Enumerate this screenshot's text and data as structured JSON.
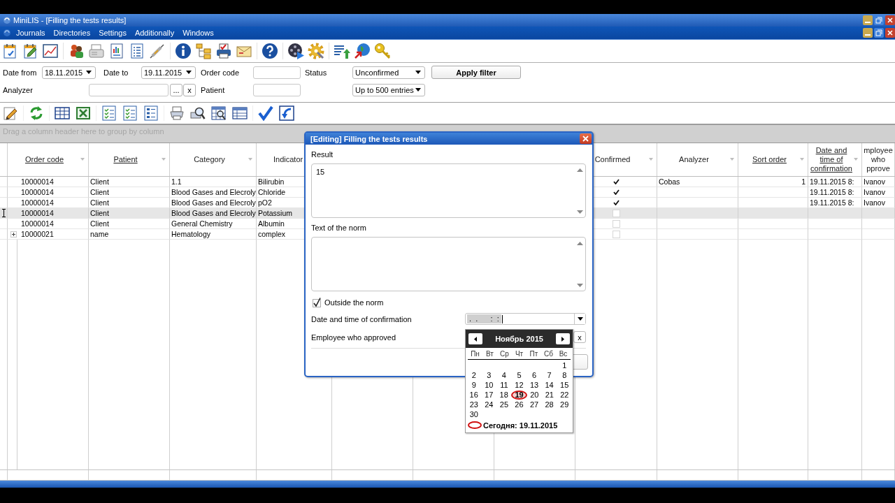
{
  "window": {
    "title": "MiniLIS - [Filling the tests results]"
  },
  "menu": [
    "Journals",
    "Directories",
    "Settings",
    "Additionally",
    "Windows"
  ],
  "filters": {
    "date_from": {
      "label": "Date from",
      "value": "18.11.2015"
    },
    "date_to": {
      "label": "Date to",
      "value": "19.11.2015"
    },
    "order_code": {
      "label": "Order code"
    },
    "status": {
      "label": "Status",
      "value": "Unconfirmed"
    },
    "apply_button": "Apply filter",
    "analyzer": {
      "label": "Analyzer",
      "browse_button": "...",
      "clear_button": "x"
    },
    "patient": {
      "label": "Patient"
    },
    "limit": {
      "value": "Up to 500 entries"
    }
  },
  "grid": {
    "group_hint": "Drag a column header here to group by column",
    "columns": [
      {
        "label": "Order code",
        "underlined": true,
        "filter_mark": true
      },
      {
        "label": "Patient",
        "underlined": true,
        "filter_mark": true
      },
      {
        "label": "Category",
        "underlined": false,
        "filter_mark": true
      },
      {
        "label": "Indicator",
        "underlined": false,
        "filter_mark": false
      },
      {
        "label": "Confirmed",
        "underlined": false,
        "filter_mark": true
      },
      {
        "label": "Analyzer",
        "underlined": false,
        "filter_mark": true
      },
      {
        "label": "Sort order",
        "underlined": true,
        "filter_mark": true
      },
      {
        "label": "Date and time of confirmation",
        "underlined": true,
        "filter_mark": true
      },
      {
        "label": "mployee who pprove",
        "underlined": false,
        "filter_mark": false
      }
    ],
    "rows": [
      {
        "selected": false,
        "expandable": false,
        "order_code": "10000014",
        "patient": "Client",
        "category": "1.1",
        "indicator": "Bilirubin",
        "confirmed": true,
        "analyzer": "Cobas",
        "sort_order": "1",
        "confirmed_at": "19.11.2015 8:",
        "approved_by": "Ivanov"
      },
      {
        "selected": false,
        "expandable": false,
        "order_code": "10000014",
        "patient": "Client",
        "category": "Blood Gases and Elecroly",
        "indicator": "Chloride",
        "confirmed": true,
        "confirmed_at": "19.11.2015 8:",
        "approved_by": "Ivanov"
      },
      {
        "selected": false,
        "expandable": false,
        "order_code": "10000014",
        "patient": "Client",
        "category": "Blood Gases and Elecroly",
        "indicator": "pO2",
        "confirmed": true,
        "confirmed_at": "19.11.2015 8:",
        "approved_by": "Ivanov"
      },
      {
        "selected": true,
        "expandable": false,
        "order_code": "10000014",
        "patient": "Client",
        "category": "Blood Gases and Elecroly",
        "indicator": "Potassium",
        "confirmed": false
      },
      {
        "selected": false,
        "expandable": false,
        "order_code": "10000014",
        "patient": "Client",
        "category": "General Chemistry",
        "indicator": "Albumin",
        "confirmed": false
      },
      {
        "selected": false,
        "expandable": true,
        "order_code": "10000021",
        "patient": "name",
        "category": "Hematology",
        "indicator": "complex",
        "confirmed": false
      }
    ]
  },
  "dialog": {
    "title": "[Editing] Filling the tests results",
    "result": {
      "label": "Result",
      "value": "15"
    },
    "norm": {
      "label": "Text of the norm"
    },
    "outside_norm": {
      "label": "Outside the norm",
      "checked": true
    },
    "confirmed_at": {
      "label": "Date and time of confirmation",
      "value": ".  .      :  :"
    },
    "approved_by": {
      "label": "Employee who approved",
      "clear_button": "x"
    }
  },
  "calendar": {
    "month": "Ноябрь 2015",
    "weekdays": [
      "Пн",
      "Вт",
      "Ср",
      "Чт",
      "Пт",
      "Сб",
      "Вс"
    ],
    "weeks": [
      [
        {
          "day": "1",
          "today": false
        }
      ],
      [
        {
          "day": "2",
          "today": false
        },
        {
          "day": "3",
          "today": false
        },
        {
          "day": "4",
          "today": false
        },
        {
          "day": "5",
          "today": false
        },
        {
          "day": "6",
          "today": false
        },
        {
          "day": "7",
          "today": false
        },
        {
          "day": "8",
          "today": false
        }
      ],
      [
        {
          "day": "9",
          "today": false
        },
        {
          "day": "10",
          "today": false
        },
        {
          "day": "11",
          "today": false
        },
        {
          "day": "12",
          "today": false
        },
        {
          "day": "13",
          "today": false
        },
        {
          "day": "14",
          "today": false
        },
        {
          "day": "15",
          "today": false
        }
      ],
      [
        {
          "day": "16",
          "today": false
        },
        {
          "day": "17",
          "today": false
        },
        {
          "day": "18",
          "today": false
        },
        {
          "day": "19",
          "today": true
        },
        {
          "day": "20",
          "today": false
        },
        {
          "day": "21",
          "today": false
        },
        {
          "day": "22",
          "today": false
        }
      ],
      [
        {
          "day": "23",
          "today": false
        },
        {
          "day": "24",
          "today": false
        },
        {
          "day": "25",
          "today": false
        },
        {
          "day": "26",
          "today": false
        },
        {
          "day": "27",
          "today": false
        },
        {
          "day": "28",
          "today": false
        },
        {
          "day": "29",
          "today": false
        }
      ],
      [
        {
          "day": "30",
          "today": false
        }
      ]
    ],
    "today_label": "Сегодня: 19.11.2015"
  }
}
